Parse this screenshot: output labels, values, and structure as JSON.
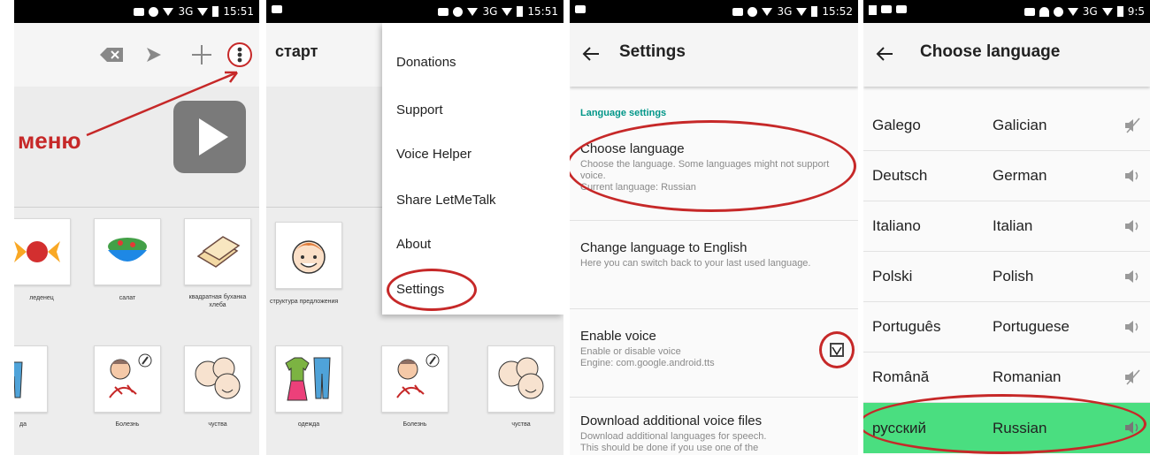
{
  "status_bars": {
    "p1_time": "15:51",
    "p2_time": "15:51",
    "p3_time": "15:52",
    "p4_time": "9:5",
    "network": "3G"
  },
  "panel1": {
    "annotation_label": "меню",
    "tiles_row1": [
      {
        "label": "леденец"
      },
      {
        "label": "салат"
      },
      {
        "label": "квадратная буханка хлеба"
      }
    ],
    "tiles_row2": [
      {
        "label": "да"
      },
      {
        "label": "Болезнь"
      },
      {
        "label": "чуства"
      }
    ]
  },
  "panel2": {
    "title": "старт",
    "tiles": [
      {
        "label": "структура предложения"
      },
      {
        "label": "одежда"
      },
      {
        "label": "Болезнь"
      },
      {
        "label": "чуства"
      }
    ],
    "menu": [
      "Donations",
      "Support",
      "Voice Helper",
      "Share LetMeTalk",
      "About",
      "Settings"
    ]
  },
  "panel3": {
    "title": "Settings",
    "section_header": "Language settings",
    "rows": [
      {
        "title": "Choose language",
        "summary": "Choose the language. Some languages might not support voice.",
        "extra": "Current language: Russian"
      },
      {
        "title": "Change language to English",
        "summary": "Here you can switch back to your last used language.",
        "extra": ""
      },
      {
        "title": "Enable voice",
        "summary": "Enable or disable voice",
        "extra": "Engine: com.google.android.tts"
      },
      {
        "title": "Download additional voice files",
        "summary": "Download additional languages for speech.",
        "extra": "This should be done if you use one of the"
      }
    ],
    "enable_voice_checked": true
  },
  "panel4": {
    "title": "Choose language",
    "languages": [
      {
        "native": "Galego",
        "english": "Galician",
        "voice": false
      },
      {
        "native": "Deutsch",
        "english": "German",
        "voice": true
      },
      {
        "native": "Italiano",
        "english": "Italian",
        "voice": true
      },
      {
        "native": "Polski",
        "english": "Polish",
        "voice": true
      },
      {
        "native": "Português",
        "english": "Portuguese",
        "voice": true
      },
      {
        "native": "Română",
        "english": "Romanian",
        "voice": false
      },
      {
        "native": "русский",
        "english": "Russian",
        "voice": true,
        "selected": true
      }
    ]
  },
  "colors": {
    "annotation_red": "#c62828",
    "teal_header": "#009688",
    "selected_row": "#4ade80"
  }
}
